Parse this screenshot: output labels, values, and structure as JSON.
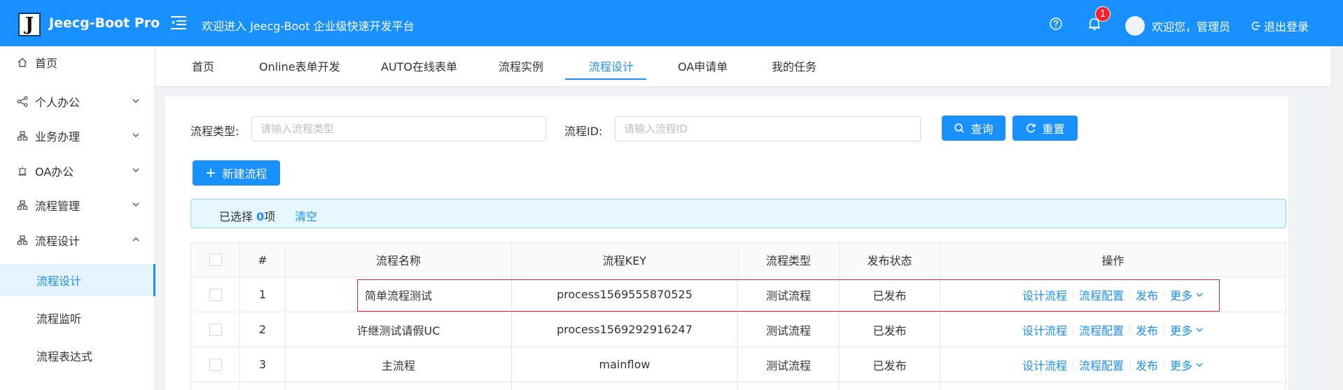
{
  "header": {
    "logo_letter": "J",
    "app_name": "Jeecg-Boot Pro",
    "title": "欢迎进入 Jeecg-Boot 企业级快速开发平台",
    "notification_count": "1",
    "welcome": "欢迎您，管理员",
    "logout": "退出登录",
    "accent_color": "#1890ff"
  },
  "sidebar": {
    "items": [
      {
        "label": "首页",
        "icon": "home-icon"
      },
      {
        "label": "个人办公",
        "icon": "share-icon"
      },
      {
        "label": "业务办理",
        "icon": "cluster-icon"
      },
      {
        "label": "OA办公",
        "icon": "alarm-icon"
      },
      {
        "label": "流程管理",
        "icon": "cluster-icon"
      },
      {
        "label": "流程设计",
        "icon": "cluster-icon"
      }
    ],
    "sub_items": [
      {
        "label": "流程设计"
      },
      {
        "label": "流程监听"
      },
      {
        "label": "流程表达式"
      }
    ]
  },
  "tabs": [
    {
      "label": "首页"
    },
    {
      "label": "Online表单开发"
    },
    {
      "label": "AUTO在线表单"
    },
    {
      "label": "流程实例"
    },
    {
      "label": "流程设计"
    },
    {
      "label": "OA申请单"
    },
    {
      "label": "我的任务"
    }
  ],
  "search": {
    "type_label": "流程类型:",
    "type_placeholder": "请输入流程类型",
    "id_label": "流程ID:",
    "id_placeholder": "请输入流程ID",
    "query_button": "查询",
    "reset_button": "重置"
  },
  "toolbar": {
    "new_button": "新建流程"
  },
  "selection": {
    "prefix": "已选择",
    "count": "0",
    "suffix": "项",
    "clear": "清空"
  },
  "table": {
    "columns": [
      "#",
      "流程名称",
      "流程KEY",
      "流程类型",
      "发布状态",
      "操作"
    ],
    "rows": [
      {
        "index": "1",
        "name": "简单流程测试",
        "key": "process1569555870525",
        "type": "测试流程",
        "status": "已发布"
      },
      {
        "index": "2",
        "name": "许继测试请假UC",
        "key": "process1569292916247",
        "type": "测试流程",
        "status": "已发布"
      },
      {
        "index": "3",
        "name": "主流程",
        "key": "mainflow",
        "type": "测试流程",
        "status": "已发布"
      }
    ],
    "actions": {
      "design": "设计流程",
      "config": "流程配置",
      "publish": "发布",
      "more": "更多"
    }
  }
}
